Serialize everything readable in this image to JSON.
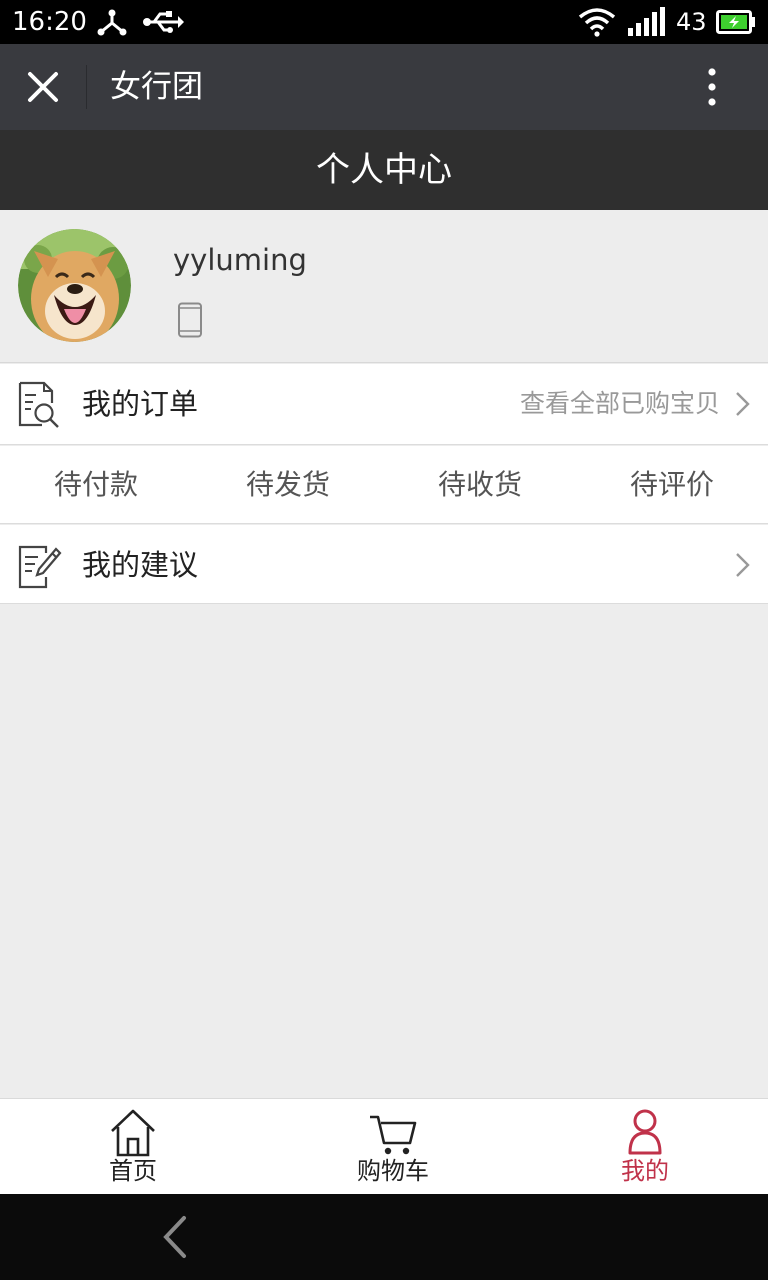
{
  "status_bar": {
    "time": "16:20",
    "battery_level": "43",
    "icons": [
      "usb-tether-icon",
      "usb-icon",
      "wifi-icon",
      "signal-icon",
      "battery-charging-icon"
    ],
    "battery_color": "#3ecf2f"
  },
  "top_bar": {
    "title": "女行团",
    "close_icon": "close-icon",
    "more_icon": "more-vertical-icon"
  },
  "page_header": {
    "title": "个人中心"
  },
  "profile": {
    "username": "yyluming",
    "avatar": "shiba-dog-avatar",
    "phone_icon": "phone-icon"
  },
  "orders": {
    "label": "我的订单",
    "view_all": "查看全部已购宝贝",
    "icon": "order-search-icon"
  },
  "order_status": [
    {
      "label": "待付款"
    },
    {
      "label": "待发货"
    },
    {
      "label": "待收货"
    },
    {
      "label": "待评价"
    }
  ],
  "suggestions": {
    "label": "我的建议",
    "icon": "edit-note-icon"
  },
  "bottom_nav": [
    {
      "label": "首页",
      "icon": "home-icon",
      "active": false
    },
    {
      "label": "购物车",
      "icon": "cart-icon",
      "active": false
    },
    {
      "label": "我的",
      "icon": "user-icon",
      "active": true
    }
  ],
  "colors": {
    "active": "#c0324a",
    "topbar": "#393a3f",
    "header": "#2f2f2f",
    "background": "#ededed"
  }
}
